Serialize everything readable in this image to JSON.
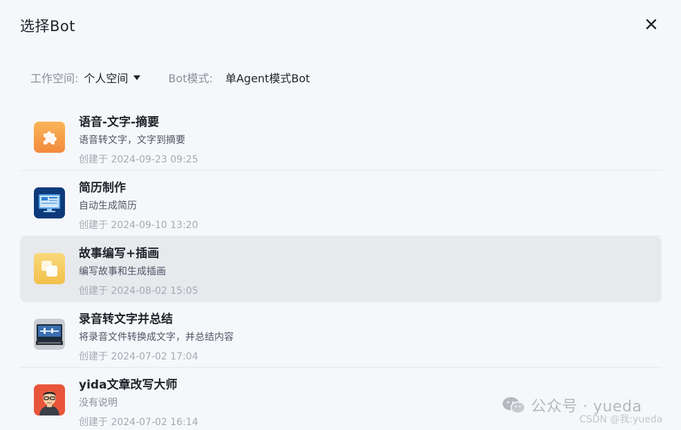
{
  "dialog": {
    "title": "选择Bot",
    "close_icon": "close-icon"
  },
  "filters": {
    "workspace_label": "工作空间:",
    "workspace_value": "个人空间",
    "mode_label": "Bot模式:",
    "mode_value": "单Agent模式Bot"
  },
  "bots": [
    {
      "name": "语音-文字-摘要",
      "desc": "语音转文字，文字到摘要",
      "created": "创建于 2024-09-23 09:25",
      "icon": "puzzle-icon",
      "selected": false
    },
    {
      "name": "简历制作",
      "desc": "自动生成简历",
      "created": "创建于 2024-09-10 13:20",
      "icon": "monitor-icon",
      "selected": false
    },
    {
      "name": "故事编写+插画",
      "desc": "编写故事和生成插画",
      "created": "创建于 2024-08-02 15:05",
      "icon": "cards-icon",
      "selected": true
    },
    {
      "name": "录音转文字并总结",
      "desc": "将录音文件转换成文字，并总结内容",
      "created": "创建于 2024-07-02 17:04",
      "icon": "recorder-icon",
      "selected": false
    },
    {
      "name": "yida文章改写大师",
      "desc": "没有说明",
      "created": "创建于 2024-07-02 16:14",
      "icon": "person-avatar-icon",
      "selected": false
    }
  ],
  "watermark": {
    "text": "公众号 · yueda",
    "csdn": "CSDN @我:yueda"
  }
}
